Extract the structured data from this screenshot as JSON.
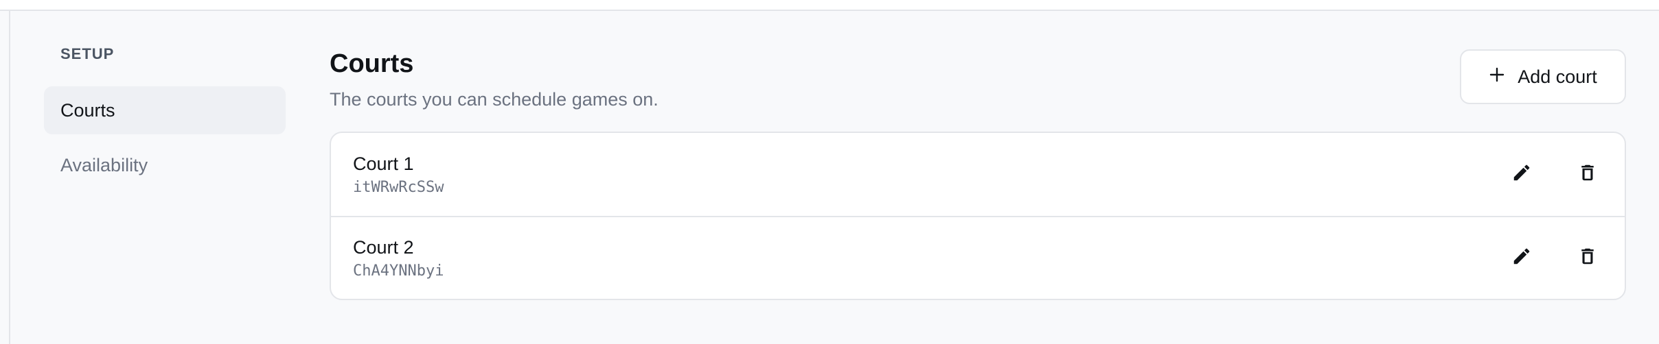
{
  "sidebar": {
    "heading": "SETUP",
    "items": [
      {
        "label": "Courts",
        "active": true
      },
      {
        "label": "Availability",
        "active": false
      }
    ]
  },
  "main": {
    "title": "Courts",
    "subtitle": "The courts you can schedule games on.",
    "add_button": {
      "label": "Add court",
      "icon": "plus-icon"
    }
  },
  "courts": [
    {
      "name": "Court 1",
      "id": "itWRwRcSSw",
      "actions": [
        "pencil-icon",
        "trash-icon"
      ]
    },
    {
      "name": "Court 2",
      "id": "ChA4YNNbyi",
      "actions": [
        "pencil-icon",
        "trash-icon"
      ]
    }
  ],
  "colors": {
    "background": "#f8f9fb",
    "card": "#ffffff",
    "border": "#e3e5e9",
    "active_item": "#eef0f4",
    "muted_text": "#6b7280",
    "text": "#111418"
  }
}
